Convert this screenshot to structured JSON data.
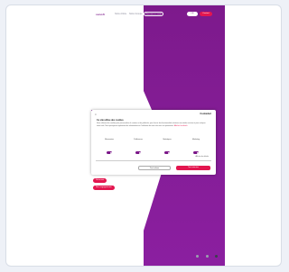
{
  "nav": {
    "logo": "sanofi",
    "links": [
      "Notre Article",
      "Notre Groupe"
    ],
    "pill_outline": "Ressources santé",
    "pill_lang": "FR",
    "pill_cta": "Contact"
  },
  "cookie_modal": {
    "brand": "Cookiebot",
    "title": "Ce site utilise des cookies",
    "body": "Nous utilisons des cookies pour personnaliser le contenu et les publicités, pour fournir des fonctionnalités relatives aux médias sociaux et pour analyser notre trafic. Nous partageons également des informations sur l'utilisation de notre site avec nos partenaires.",
    "link": "Afficher les détails",
    "toggles": [
      {
        "label": "Nécessaires",
        "on": true
      },
      {
        "label": "Préférences",
        "on": true
      },
      {
        "label": "Statistiques",
        "on": true
      },
      {
        "label": "Marketing",
        "on": true
      }
    ],
    "details_label": "Afficher les détails",
    "deny_label": "Tout refuser",
    "allow_label": "Tout autoriser"
  },
  "page_buttons": {
    "primary": "Découvrir",
    "secondary": "Nos engagements"
  },
  "colors": {
    "brand_purple": "#7a1688",
    "accent_red": "#e3164f"
  },
  "pager": {
    "count": 3,
    "active": 2
  }
}
